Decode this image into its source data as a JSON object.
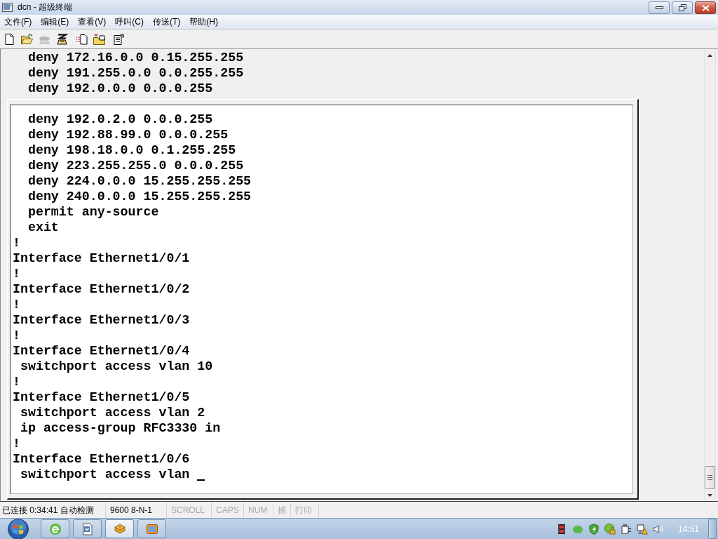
{
  "window": {
    "title": "dcn - 超级终端"
  },
  "menu": [
    {
      "label": "文件(F)"
    },
    {
      "label": "编辑(E)"
    },
    {
      "label": "查看(V)"
    },
    {
      "label": "呼叫(C)"
    },
    {
      "label": "传送(T)"
    },
    {
      "label": "帮助(H)"
    }
  ],
  "toolbar": [
    {
      "kind": "new",
      "disabled": false
    },
    {
      "kind": "open",
      "disabled": false
    },
    {
      "kind": "call",
      "disabled": true
    },
    {
      "kind": "hang_up",
      "disabled": false
    },
    {
      "kind": "send",
      "disabled": false
    },
    {
      "kind": "receive",
      "disabled": false
    },
    {
      "kind": "properties",
      "disabled": false
    }
  ],
  "terminal": {
    "lines": [
      {
        "kind": "acl_entry",
        "text": "deny 172.16.0.0 0.15.255.255"
      },
      {
        "kind": "acl_entry",
        "text": "deny 191.255.0.0 0.0.255.255"
      },
      {
        "kind": "acl_entry",
        "text": "deny 192.0.0.0 0.0.0.255"
      }
    ],
    "panel_lines": [
      {
        "kind": "acl_entry",
        "text": "deny 192.0.2.0 0.0.0.255",
        "cursor": false
      },
      {
        "kind": "acl_entry",
        "text": "deny 192.88.99.0 0.0.0.255",
        "cursor": false
      },
      {
        "kind": "acl_entry",
        "text": "deny 198.18.0.0 0.1.255.255",
        "cursor": false
      },
      {
        "kind": "acl_entry",
        "text": "deny 223.255.255.0 0.0.0.255",
        "cursor": false
      },
      {
        "kind": "acl_entry",
        "text": "deny 224.0.0.0 15.255.255.255",
        "cursor": false
      },
      {
        "kind": "acl_entry",
        "text": "deny 240.0.0.0 15.255.255.255",
        "cursor": false
      },
      {
        "kind": "acl_entry",
        "text": "permit any-source",
        "cursor": false
      },
      {
        "kind": "acl_entry",
        "text": "exit",
        "cursor": false
      },
      {
        "kind": "statement",
        "text": "!",
        "cursor": false
      },
      {
        "kind": "statement",
        "text": "Interface Ethernet1/0/1",
        "cursor": false
      },
      {
        "kind": "statement",
        "text": "!",
        "cursor": false
      },
      {
        "kind": "statement",
        "text": "Interface Ethernet1/0/2",
        "cursor": false
      },
      {
        "kind": "statement",
        "text": "!",
        "cursor": false
      },
      {
        "kind": "statement",
        "text": "Interface Ethernet1/0/3",
        "cursor": false
      },
      {
        "kind": "statement",
        "text": "!",
        "cursor": false
      },
      {
        "kind": "statement",
        "text": "Interface Ethernet1/0/4",
        "cursor": false
      },
      {
        "kind": "interface_setting",
        "text": "switchport access vlan 10",
        "cursor": false
      },
      {
        "kind": "statement",
        "text": "!",
        "cursor": false
      },
      {
        "kind": "statement",
        "text": "Interface Ethernet1/0/5",
        "cursor": false
      },
      {
        "kind": "interface_setting",
        "text": "switchport access vlan 2",
        "cursor": false
      },
      {
        "kind": "interface_setting",
        "text": "ip access-group RFC3330 in",
        "cursor": false
      },
      {
        "kind": "statement",
        "text": "!",
        "cursor": false
      },
      {
        "kind": "statement",
        "text": "Interface Ethernet1/0/6",
        "cursor": false
      },
      {
        "kind": "interface_setting",
        "text": "switchport access vlan",
        "cursor": true
      }
    ]
  },
  "status_bar": {
    "connection": "已连接 0:34:41",
    "emulation": "自动检测",
    "port_settings": "9600 8-N-1",
    "indicators": [
      {
        "label": "SCROLL",
        "on": false
      },
      {
        "label": "CAPS",
        "on": false
      },
      {
        "label": "NUM",
        "on": false
      },
      {
        "label": "捕",
        "on": false
      },
      {
        "label": "打印",
        "on": false
      }
    ]
  },
  "taskbar": {
    "apps": [
      {
        "kind": "browser",
        "selected": false
      },
      {
        "kind": "document",
        "selected": false
      },
      {
        "kind": "terminal",
        "selected": true
      },
      {
        "kind": "media",
        "selected": false
      }
    ],
    "clock": "14:51"
  }
}
